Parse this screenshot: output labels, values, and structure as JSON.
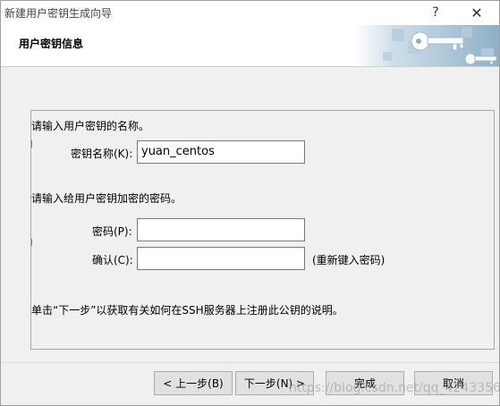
{
  "window": {
    "title": "新建用户密钥生成向导",
    "help_button": "?",
    "close_button": "✕"
  },
  "header": {
    "title": "用户密钥信息",
    "art_icon": "key-icon"
  },
  "form": {
    "name_prompt": "请输入用户密钥的名称。",
    "name_label": "密钥名称(K):",
    "name_value": "yuan_centos",
    "password_prompt": "请输入给用户密钥加密的密码。",
    "password_label": "密码(P):",
    "password_value": "",
    "confirm_label": "确认(C):",
    "confirm_value": "",
    "confirm_hint": "(重新键入密码)",
    "info_text": "单击“下一步”以获取有关如何在SSH服务器上注册此公钥的说明。"
  },
  "footer": {
    "back_label": "< 上一步(B)",
    "next_label": "下一步(N) >",
    "finish_label": "完成",
    "cancel_label": "取消",
    "watermark": "https://blog.csdn.net/qq_42433562"
  }
}
